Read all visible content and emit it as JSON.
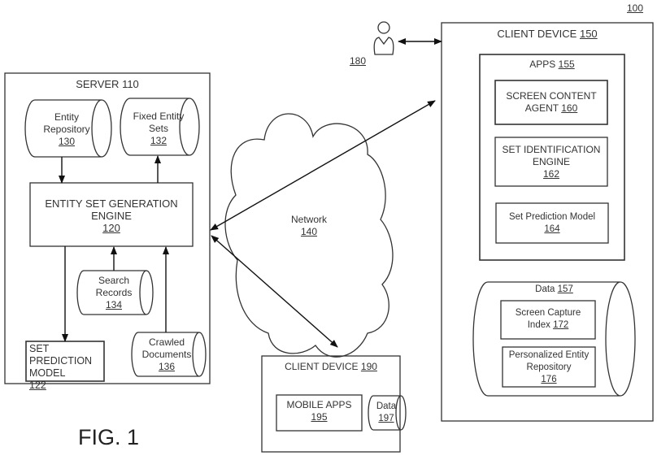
{
  "figure_label": "FIG. 1",
  "system_ref": "100",
  "user": {
    "ref": "180"
  },
  "server": {
    "title": "SERVER",
    "ref": "110",
    "entity_repository": {
      "label": "Entity Repository",
      "ref": "130"
    },
    "fixed_entity_sets": {
      "label": "Fixed Entity Sets",
      "ref": "132"
    },
    "engine": {
      "label": "ENTITY SET GENERATION ENGINE",
      "ref": "120"
    },
    "search_records": {
      "label": "Search Records",
      "ref": "134"
    },
    "crawled_documents": {
      "label": "Crawled Documents",
      "ref": "136"
    },
    "set_prediction_model": {
      "label": "SET PREDICTION MODEL",
      "ref": "122"
    }
  },
  "network": {
    "label": "Network",
    "ref": "140"
  },
  "client_150": {
    "title": "CLIENT DEVICE",
    "ref": "150",
    "apps": {
      "title": "APPS",
      "ref": "155",
      "screen_content_agent": {
        "label": "SCREEN CONTENT AGENT",
        "ref": "160"
      },
      "set_identification_engine": {
        "label": "SET IDENTIFICATION ENGINE",
        "ref": "162"
      },
      "set_prediction_model": {
        "label": "Set Prediction Model",
        "ref": "164"
      }
    },
    "data": {
      "title": "Data",
      "ref": "157",
      "screen_capture_index": {
        "label": "Screen Capture Index",
        "ref": "172"
      },
      "personalized_entity_repository": {
        "label": "Personalized Entity Repository",
        "ref": "176"
      }
    }
  },
  "client_190": {
    "title": "CLIENT DEVICE",
    "ref": "190",
    "mobile_apps": {
      "label": "MOBILE APPS",
      "ref": "195"
    },
    "data": {
      "label": "Data",
      "ref": "197"
    }
  }
}
